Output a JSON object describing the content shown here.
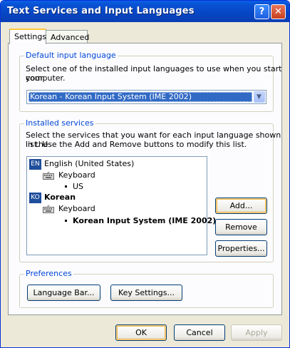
{
  "window": {
    "title": "Text Services and Input Languages"
  },
  "titlebar_buttons": {
    "help": "?",
    "close": "✕"
  },
  "tabs": [
    {
      "label": "Settings",
      "active": true
    },
    {
      "label": "Advanced",
      "active": false
    }
  ],
  "default_input": {
    "group_label": "Default input language",
    "description_line1": "Select one of the installed input languages to use when you start your",
    "description_line2": "computer.",
    "selected": "Korean - Korean Input System (IME 2002)"
  },
  "installed_services": {
    "group_label": "Installed services",
    "description_line1": "Select the services that you want for each input language shown in the",
    "description_line2": "list. Use the Add and Remove buttons to modify this list.",
    "tree": [
      {
        "badge": "EN",
        "language": "English (United States)",
        "category": "Keyboard",
        "service": "US"
      },
      {
        "badge": "KO",
        "language": "Korean",
        "category": "Keyboard",
        "service": "Korean Input System (IME 2002)"
      }
    ],
    "buttons": {
      "add": "Add...",
      "remove": "Remove",
      "properties": "Properties..."
    }
  },
  "preferences": {
    "group_label": "Preferences",
    "language_bar": "Language Bar...",
    "key_settings": "Key Settings..."
  },
  "footer": {
    "ok": "OK",
    "cancel": "Cancel",
    "apply": "Apply"
  }
}
